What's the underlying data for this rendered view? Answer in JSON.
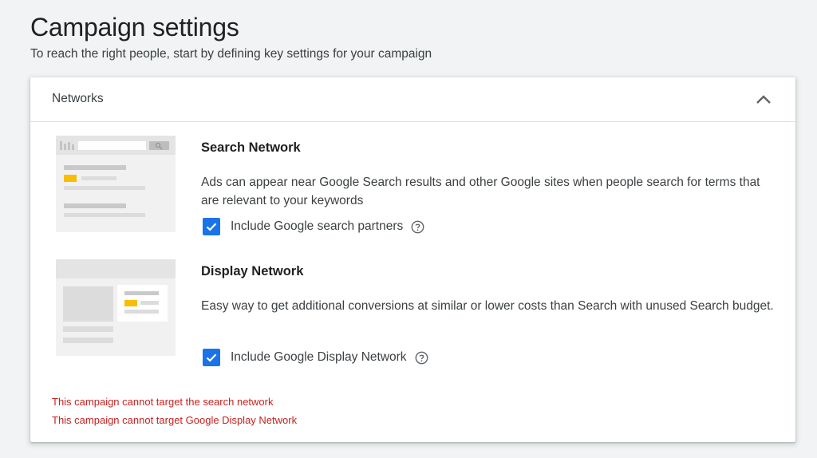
{
  "header": {
    "title": "Campaign settings",
    "subtitle": "To reach the right people, start by defining key settings for your campaign"
  },
  "card": {
    "title": "Networks",
    "networks": [
      {
        "title": "Search Network",
        "description": "Ads can appear near Google Search results and other Google sites when people search for terms that are relevant to your keywords",
        "checkbox_label": "Include Google search partners",
        "checked": true
      },
      {
        "title": "Display Network",
        "description": "Easy way to get additional conversions at similar or lower costs than Search with unused Search budget.",
        "checkbox_label": "Include Google Display Network",
        "checked": true
      }
    ],
    "errors": [
      "This campaign cannot target the search network",
      "This campaign cannot target Google Display Network"
    ]
  },
  "colors": {
    "accent": "#1a73e8",
    "error": "#c5221f",
    "highlight": "#fbbc04"
  },
  "icons": {
    "collapse": "chevron-up-icon",
    "help": "help-circle-icon",
    "check": "check-icon"
  }
}
